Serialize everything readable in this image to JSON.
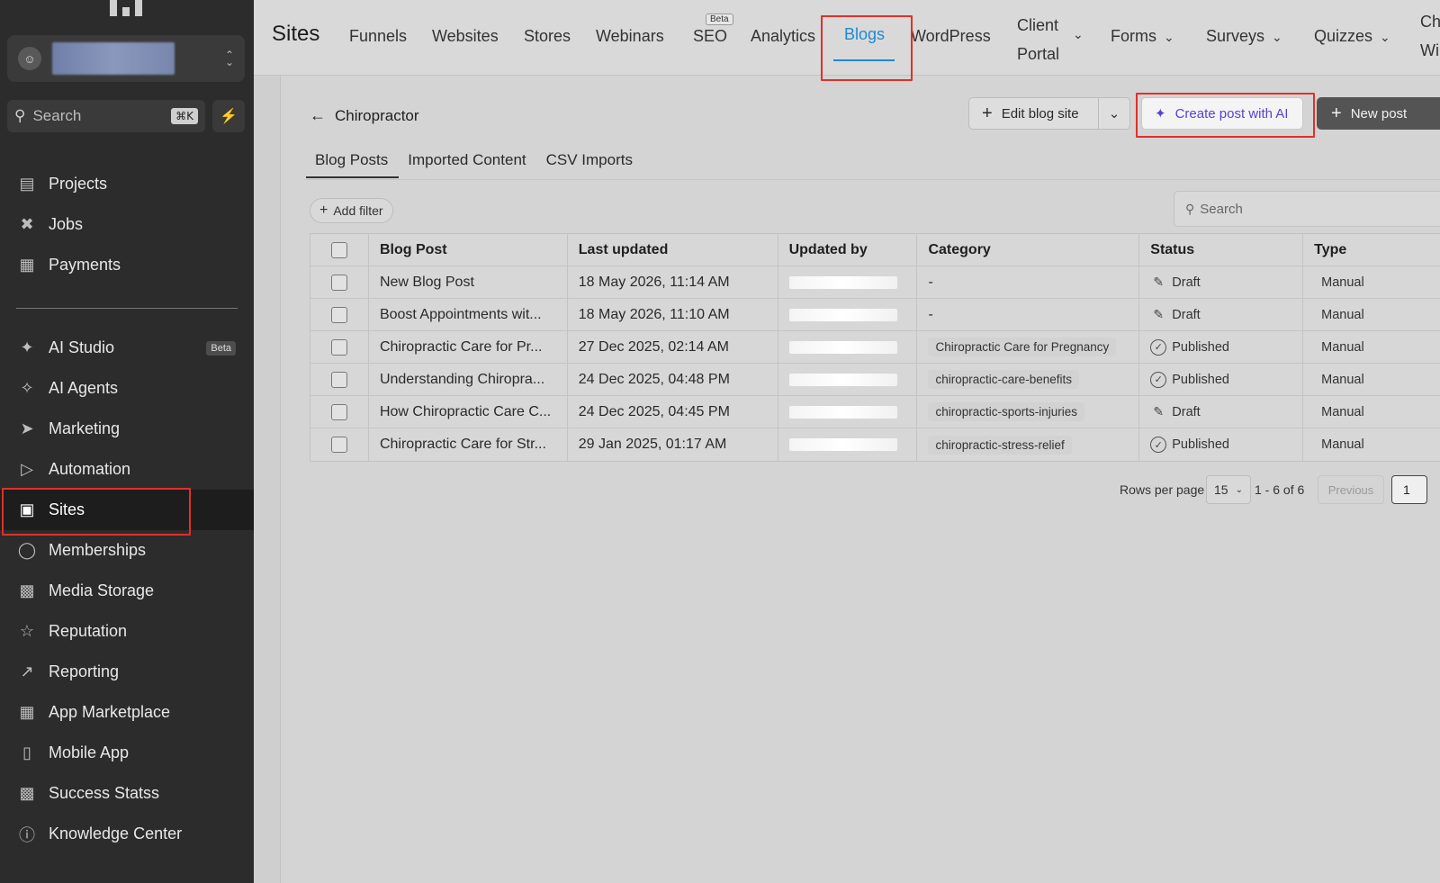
{
  "sidebar": {
    "search_placeholder": "Search",
    "search_shortcut": "⌘K",
    "items": [
      {
        "label": "Projects"
      },
      {
        "label": "Jobs"
      },
      {
        "label": "Payments"
      },
      {
        "label": "AI Studio",
        "badge": "Beta"
      },
      {
        "label": "AI Agents"
      },
      {
        "label": "Marketing"
      },
      {
        "label": "Automation"
      },
      {
        "label": "Sites"
      },
      {
        "label": "Memberships"
      },
      {
        "label": "Media Storage"
      },
      {
        "label": "Reputation"
      },
      {
        "label": "Reporting"
      },
      {
        "label": "App Marketplace"
      },
      {
        "label": "Mobile App"
      },
      {
        "label": "Success Statss"
      },
      {
        "label": "Knowledge Center"
      }
    ]
  },
  "topnav": {
    "title": "Sites",
    "tabs": [
      "Funnels",
      "Websites",
      "Stores",
      "Webinars",
      "SEO",
      "Analytics",
      "Blogs",
      "WordPress",
      "Client",
      "Portal",
      "Forms",
      "Surveys",
      "Quizzes",
      "Ch",
      "Wi"
    ],
    "seo_badge": "Beta",
    "active_tab": "Blogs"
  },
  "page": {
    "back_title": "Chiropractor",
    "edit_blog_label": "Edit blog site",
    "create_ai_label": "Create post with AI",
    "new_post_label": "New post",
    "subtabs": [
      "Blog Posts",
      "Imported Content",
      "CSV Imports"
    ],
    "add_filter_label": "Add filter",
    "search_placeholder": "Search"
  },
  "table": {
    "columns": [
      "Blog Post",
      "Last updated",
      "Updated by",
      "Category",
      "Status",
      "Type"
    ],
    "rows": [
      {
        "post": "New Blog Post",
        "updated": "18 May 2026, 11:14 AM",
        "category": "-",
        "category_pill": false,
        "status": "Draft",
        "type": "Manual"
      },
      {
        "post": "Boost Appointments wit...",
        "updated": "18 May 2026, 11:10 AM",
        "category": "-",
        "category_pill": false,
        "status": "Draft",
        "type": "Manual"
      },
      {
        "post": "Chiropractic Care for Pr...",
        "updated": "27 Dec 2025, 02:14 AM",
        "category": "Chiropractic Care for Pregnancy",
        "category_pill": true,
        "status": "Published",
        "type": "Manual"
      },
      {
        "post": "Understanding Chiropra...",
        "updated": "24 Dec 2025, 04:48 PM",
        "category": "chiropractic-care-benefits",
        "category_pill": true,
        "status": "Published",
        "type": "Manual"
      },
      {
        "post": "How Chiropractic Care C...",
        "updated": "24 Dec 2025, 04:45 PM",
        "category": "chiropractic-sports-injuries",
        "category_pill": true,
        "status": "Draft",
        "type": "Manual"
      },
      {
        "post": "Chiropractic Care for Str...",
        "updated": "29 Jan 2025, 01:17 AM",
        "category": "chiropractic-stress-relief",
        "category_pill": true,
        "status": "Published",
        "type": "Manual"
      }
    ]
  },
  "pagination": {
    "rows_per_page_label": "Rows per page",
    "rows_per_page": "15",
    "range": "1 - 6 of 6",
    "previous_label": "Previous",
    "page": "1"
  },
  "colors": {
    "accent": "#1f8ad1",
    "ai_accent": "#5b3fd6",
    "highlight": "#e0302b",
    "sidebar_bg": "#2c2c2c"
  }
}
